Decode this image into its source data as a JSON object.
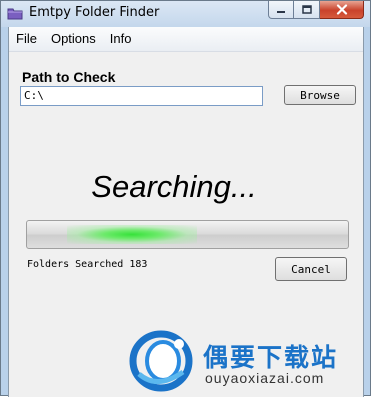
{
  "window": {
    "title": "Emtpy Folder Finder",
    "accent_close": "#c9422b"
  },
  "menu": {
    "items": [
      "File",
      "Options",
      "Info"
    ]
  },
  "path": {
    "label": "Path to Check",
    "value": "C:\\"
  },
  "buttons": {
    "browse": "Browse",
    "cancel": "Cancel"
  },
  "status": {
    "searching": "Searching...",
    "folders_label": "Folders Searched",
    "folders_count": "183"
  },
  "progress": {
    "style": "marquee",
    "glow_color": "#36e23a"
  },
  "watermark": {
    "text": "偶要下载站",
    "url": "ouyaoxiazai.com",
    "color": "#1b73c8"
  }
}
